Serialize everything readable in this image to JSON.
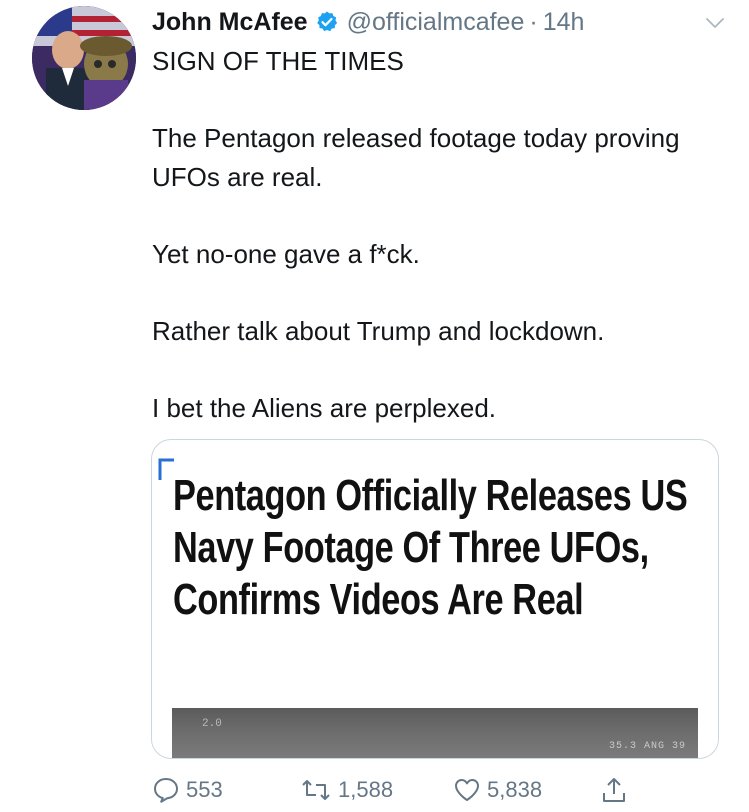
{
  "tweet": {
    "display_name": "John McAfee",
    "handle": "@officialmcafee",
    "separator": "·",
    "time": "14h",
    "text": "SIGN OF THE TIMES\n\nThe Pentagon released footage today proving UFOs are real.\n\nYet no-one gave a f*ck.\n\nRather talk about Trump and lockdown.\n\nI bet the Aliens are perplexed."
  },
  "card": {
    "headline": "Pentagon Officially Releases US Navy Footage Of Three UFOs, Confirms Videos Are Real",
    "hud_left": "2.0",
    "hud_right": "35.3  ANG 39"
  },
  "actions": {
    "replies": "553",
    "retweets": "1,588",
    "likes": "5,838"
  },
  "colors": {
    "text": "#14171a",
    "secondary": "#657786",
    "verified": "#1da1f2",
    "border": "#ccd6dd"
  }
}
